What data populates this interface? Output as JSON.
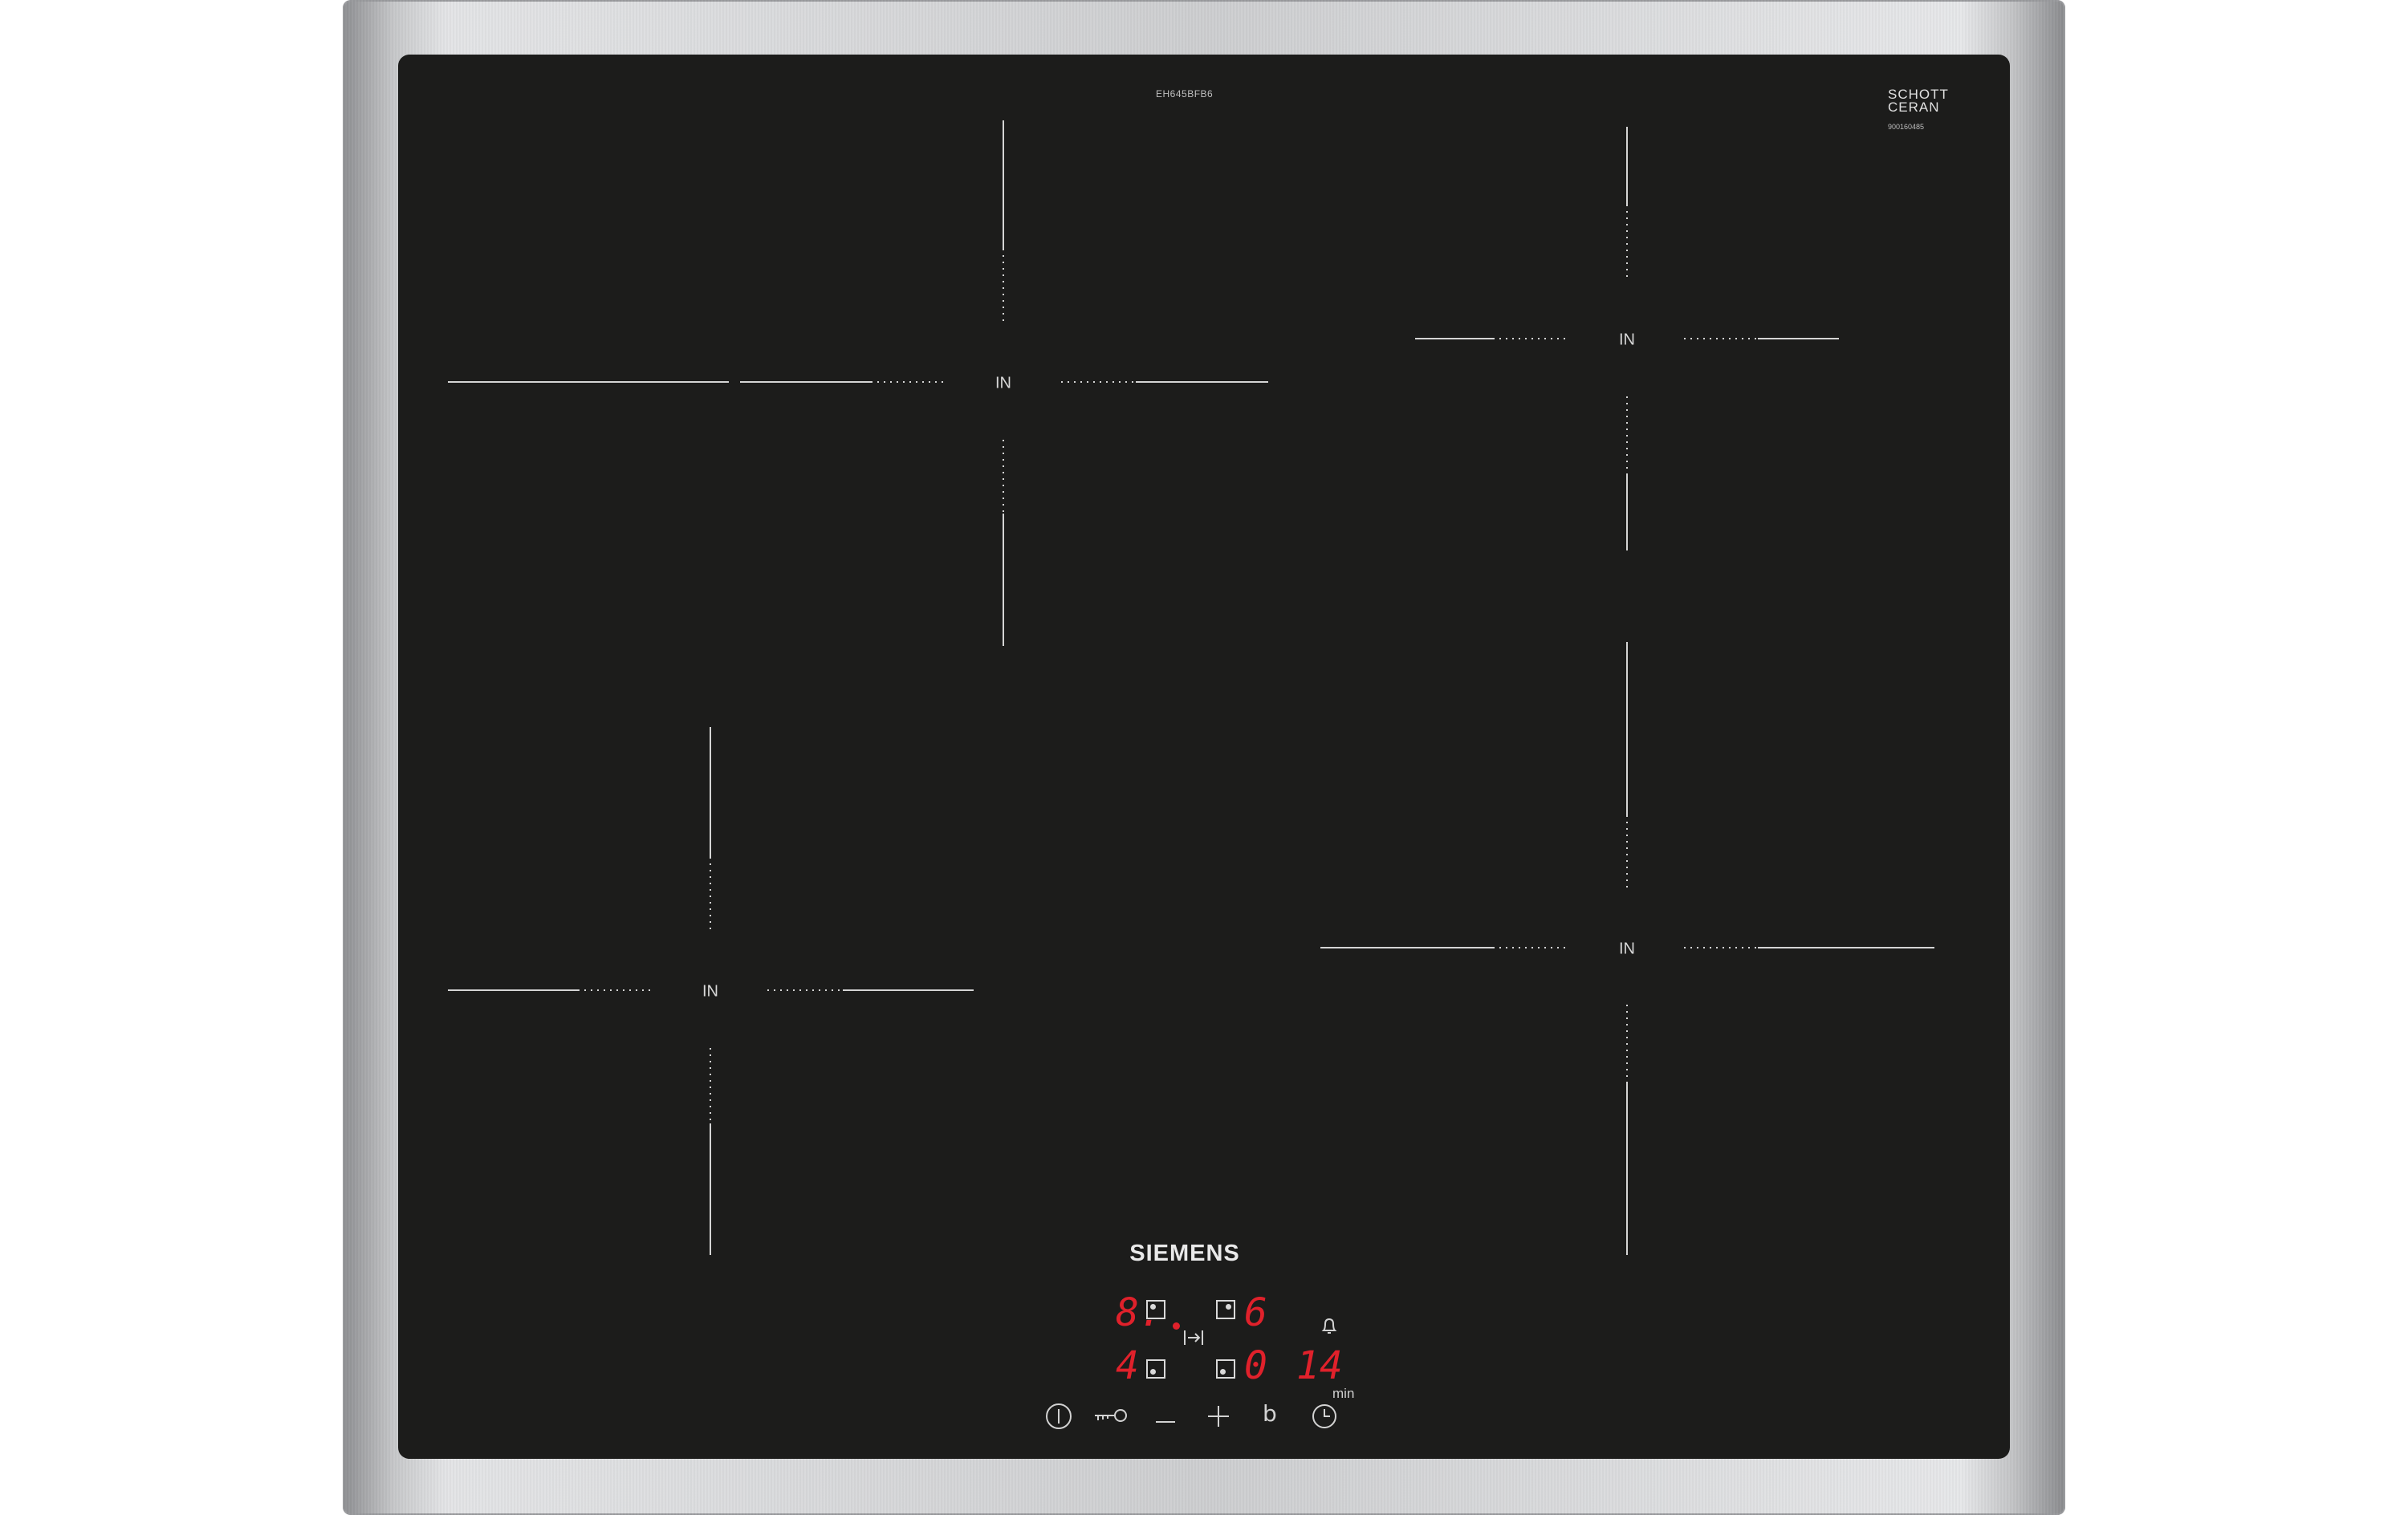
{
  "hob": {
    "brand": "SIEMENS",
    "model_code": "EH645BFB6",
    "glass_maker": {
      "line1": "SCHOTT",
      "line2": "CERAN",
      "code": "900160485"
    },
    "zones": [
      {
        "label": "IN"
      },
      {
        "label": "IN"
      },
      {
        "label": "IN"
      },
      {
        "label": "IN"
      }
    ],
    "display": {
      "front_left_level": "8.",
      "rear_right_level": "6",
      "rear_left_level": "4",
      "front_right_level": "0",
      "timer_value": "14",
      "timer_unit": "min"
    },
    "controls": {
      "power": "power-icon",
      "lock": "child-lock-key-icon",
      "minus": "minus-icon",
      "plus": "plus-icon",
      "boost": "b",
      "timer": "clock-icon"
    },
    "colors": {
      "glass": "#1c1c1b",
      "display_red": "#e0212b",
      "frame": "#cfd0d2"
    }
  }
}
